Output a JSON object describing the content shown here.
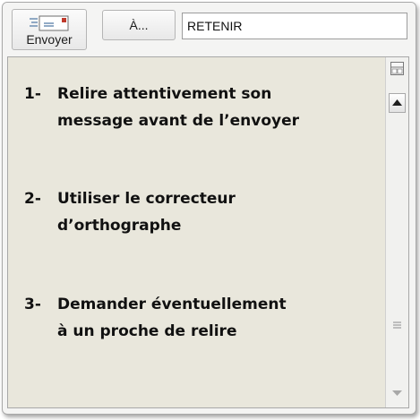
{
  "toolbar": {
    "send_label": "Envoyer",
    "send_icon": "envelope-send-icon",
    "to_label": "À..."
  },
  "subject": {
    "value": "RETENIR"
  },
  "message": {
    "items": [
      {
        "number": "1-",
        "text": "Relire attentivement son\nmessage avant de l’envoyer"
      },
      {
        "number": "2-",
        "text": "Utiliser le correcteur\nd’orthographe"
      },
      {
        "number": "3-",
        "text": "Demander éventuellement\nà un proche de relire"
      }
    ]
  },
  "scrollbar": {
    "split_icon": "split-window-icon",
    "up_icon": "triangle-up-icon",
    "down_icon": "triangle-down-icon",
    "grip_icon": "grip-lines-icon"
  },
  "colors": {
    "body_background": "#e9e7dc",
    "envelope_accent": "#c0392b"
  }
}
